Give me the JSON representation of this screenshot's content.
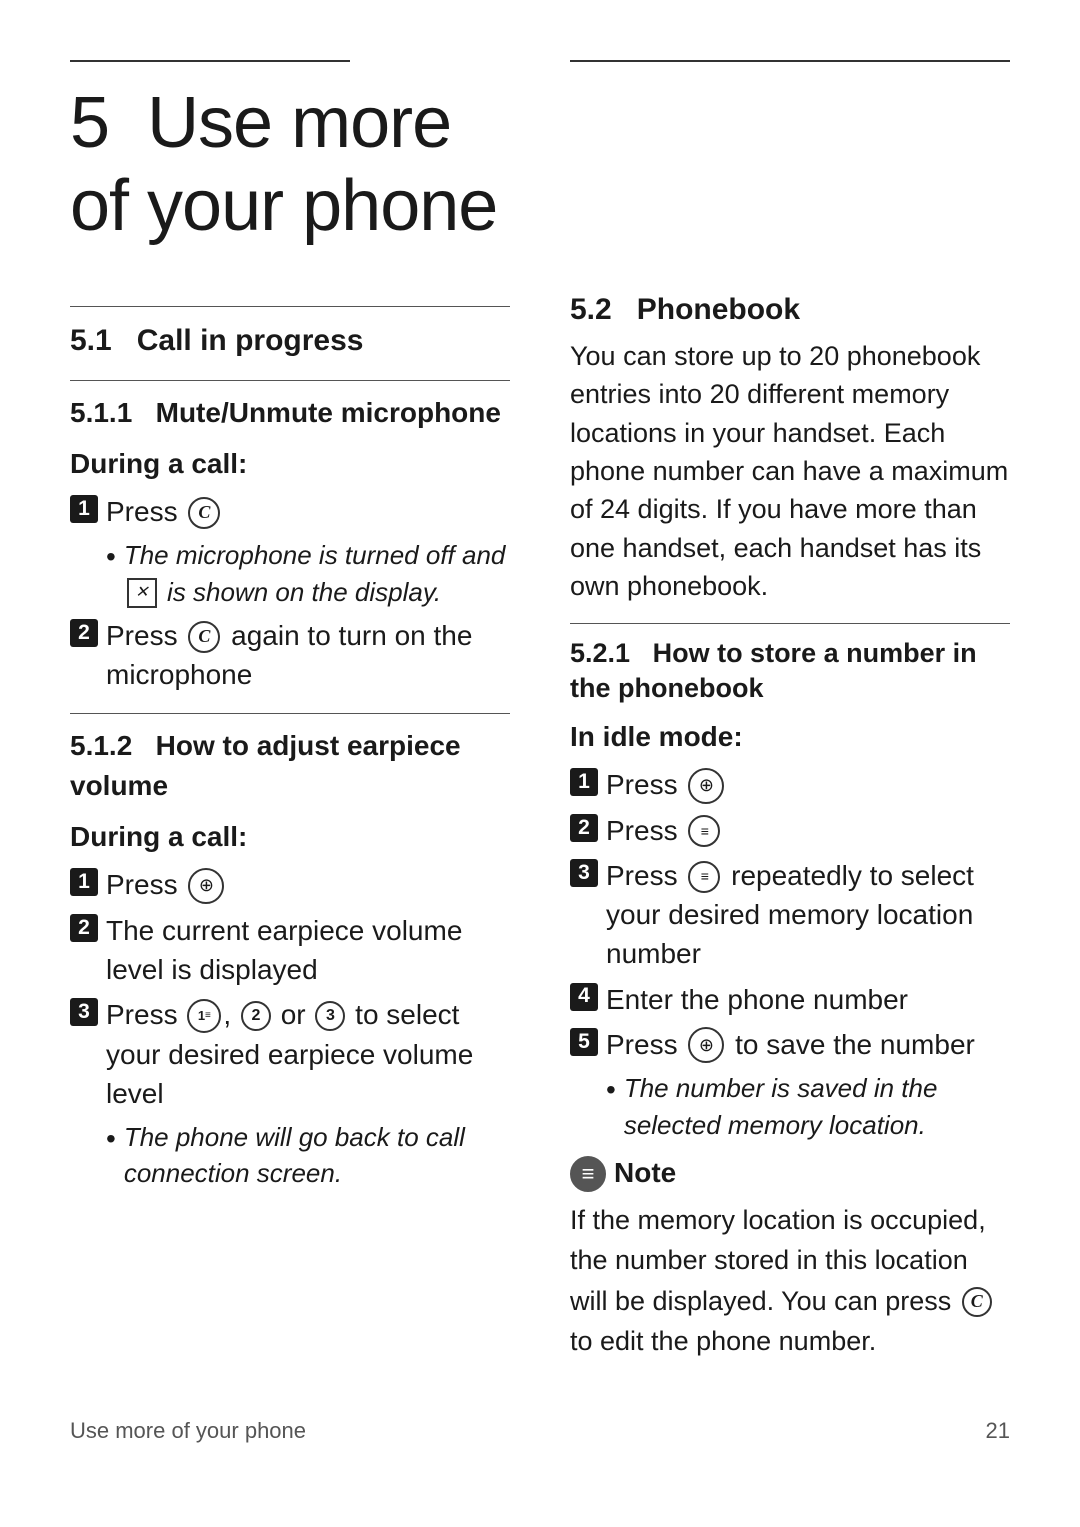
{
  "page": {
    "chapter_number": "5",
    "chapter_title": "Use more of your phone",
    "footer_text": "Use more of your phone",
    "footer_page": "21"
  },
  "left_col": {
    "section_51": {
      "heading": "5.1",
      "heading_text": "Call in progress"
    },
    "section_511": {
      "heading": "5.1.1",
      "heading_text": "Mute/Unmute microphone"
    },
    "during_a_call_511": "During a call:",
    "steps_511": [
      {
        "num": "1",
        "text": "Press"
      },
      {
        "bullet": true,
        "text": "The microphone is turned off and",
        "text2": "is shown on the display."
      },
      {
        "num": "2",
        "text": "Press",
        "text2": "again to turn on the microphone"
      }
    ],
    "section_512": {
      "heading": "5.1.2",
      "heading_text": "How to adjust earpiece volume"
    },
    "during_a_call_512": "During a call:",
    "steps_512": [
      {
        "num": "1",
        "text": "Press"
      },
      {
        "num": "2",
        "text": "The current earpiece volume level is displayed"
      },
      {
        "num": "3",
        "text": "Press",
        "mid": ",",
        "mid2": "or",
        "text2": "to select your desired earpiece volume level"
      },
      {
        "bullet": true,
        "text": "The phone will go back to call connection screen."
      }
    ]
  },
  "right_col": {
    "section_52": {
      "heading": "5.2",
      "heading_text": "Phonebook"
    },
    "phonebook_intro": "You can store up to 20 phonebook entries into 20 different memory locations in your handset. Each phone number can have a maximum of 24 digits. If you have more than one handset, each handset has its own phonebook.",
    "section_521": {
      "heading": "5.2.1",
      "heading_text": "How to store a number in the phonebook"
    },
    "in_idle": "In idle mode:",
    "steps_521": [
      {
        "num": "1",
        "text": "Press"
      },
      {
        "num": "2",
        "text": "Press"
      },
      {
        "num": "3",
        "text": "Press",
        "text2": "repeatedly to select your desired memory location number"
      },
      {
        "num": "4",
        "text": "Enter the phone number"
      },
      {
        "num": "5",
        "text": "Press",
        "text2": "to save the number"
      },
      {
        "bullet": true,
        "text": "The number is saved in the selected memory location."
      }
    ],
    "note": {
      "label": "Note",
      "text": "If the memory location is occupied, the number stored in this location will be displayed. You can press",
      "text2": "to edit the phone number."
    }
  }
}
